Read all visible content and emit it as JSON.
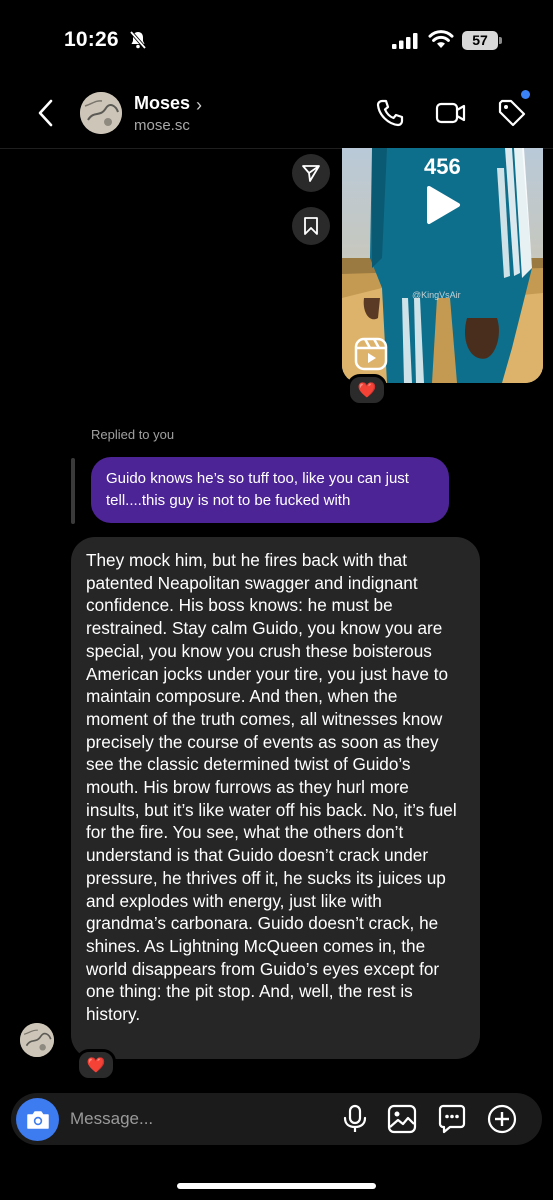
{
  "status_bar": {
    "time": "10:26",
    "battery": "57"
  },
  "header": {
    "name": "Moses",
    "username": "mose.sc"
  },
  "reel": {
    "jersey_number": "456",
    "watermark": "@KingVsAir"
  },
  "reactions": {
    "reel": "❤️",
    "message": "❤️"
  },
  "reply": {
    "label": "Replied to you",
    "quoted_text": "Guido knows he’s so tuff too, like you can just tell....this guy is not to be fucked with"
  },
  "message": {
    "text": "They mock him, but he fires back with that patented Neapolitan swagger and indignant confidence. His boss knows: he must be restrained. Stay calm Guido, you know you are special, you know you crush these boisterous American jocks under your tire, you just have to maintain composure. And then, when the moment of the truth comes, all witnesses know precisely the course of events as soon as they see the classic determined twist of Guido’s mouth. His brow furrows as they hurl more insults, but it’s like water off his back. No, it’s fuel for the fire. You see, what the others don’t understand is that Guido doesn’t crack under pressure, he thrives off it, he sucks its juices up and explodes with energy, just like with grandma’s carbonara. Guido doesn’t crack, he shines. As Lightning McQueen comes in, the world disappears from Guido’s eyes except for one thing: the pit stop. And, well, the rest is history."
  },
  "composer": {
    "placeholder": "Message..."
  },
  "icons": {
    "status": [
      "bell-slash-icon",
      "signal-icon",
      "wifi-icon",
      "battery-icon"
    ],
    "header": [
      "back-chevron-icon",
      "phone-icon",
      "video-camera-icon",
      "tag-icon"
    ],
    "reel": [
      "share-send-icon",
      "bookmark-icon",
      "play-icon",
      "reels-icon"
    ],
    "composer": [
      "camera-icon",
      "microphone-icon",
      "gallery-icon",
      "sticker-icon",
      "plus-circle-icon"
    ]
  },
  "colors": {
    "background": "#000000",
    "sent_bubble": "#4d2496",
    "received_bubble": "#262626",
    "camera_button": "#3d7bf0",
    "notification_dot": "#3b82f6"
  }
}
